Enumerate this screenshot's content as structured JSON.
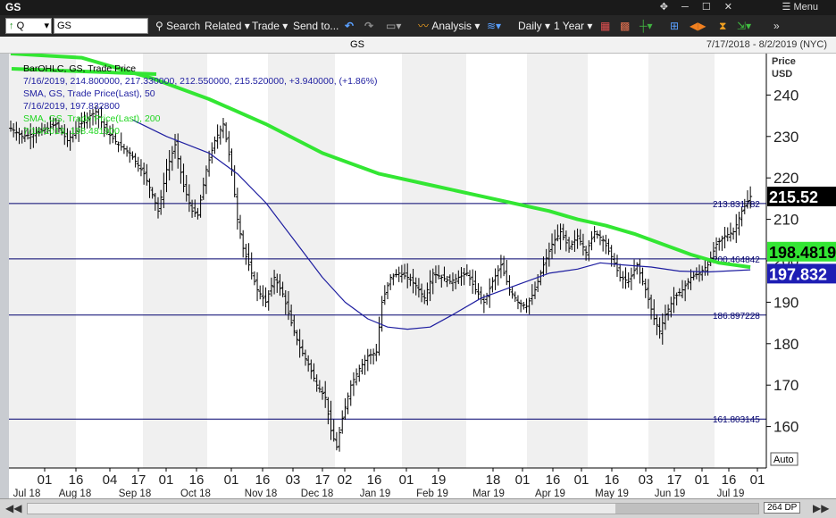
{
  "window": {
    "title": "GS",
    "menu_label": "Menu",
    "window_controls": "✥ ─ ☐ ✕"
  },
  "toolbar": {
    "symbol_type": "Q",
    "symbol_value": "GS",
    "search_label": "Search",
    "related_label": "Related",
    "trade_label": "Trade",
    "send_label": "Send to...",
    "analysis_label": "Analysis",
    "period_label": "Daily",
    "range_label": "1 Year"
  },
  "header": {
    "symbol": "GS",
    "date_range": "7/17/2018 - 8/2/2019 (NYC)"
  },
  "legend": {
    "ohlc_title": "BarOHLC, GS, Trade Price",
    "ohlc_values": "7/16/2019, 214.800000, 217.330000, 212.550000, 215.520000, +3.940000, (+1.86%)",
    "sma50_title": "SMA, GS, Trade Price(Last), 50",
    "sma50_value": "7/16/2019, 197.832800",
    "sma200_title": "SMA, GS, Trade Price(Last), 200",
    "sma200_value": "7/16/2019, 198.481900"
  },
  "axis": {
    "price_label": "Price",
    "unit_label": "USD",
    "auto_label": "Auto"
  },
  "footer": {
    "zoom_label": "264 DP"
  },
  "colors": {
    "ohlc": "#000000",
    "sma50": "#1e1ea0",
    "sma200": "#33e633",
    "hline": "#00006e",
    "band": "#f0f0f0",
    "last_price_bg": "#000000",
    "sma200_bg": "#33e633",
    "sma50_bg": "#1e1eb4"
  },
  "chart_data": {
    "type": "line",
    "title": "GS",
    "ylim": [
      150,
      250
    ],
    "y_ticks": [
      160,
      170,
      180,
      190,
      200,
      210,
      220,
      230,
      240
    ],
    "y_tick_labels": [
      "160",
      "170",
      "180",
      "190",
      "200",
      "210",
      "220",
      "230",
      "240"
    ],
    "x_tick_labels": [
      "01",
      "16",
      "04",
      "17",
      "01",
      "16",
      "01",
      "16",
      "03",
      "17",
      "02",
      "16",
      "01",
      "19",
      "18",
      "01",
      "16",
      "01",
      "16",
      "03",
      "17",
      "01",
      "16",
      "01"
    ],
    "month_labels": [
      "Jul 18",
      "Aug 18",
      "Sep 18",
      "Oct 18",
      "Nov 18",
      "Dec 18",
      "Jan 19",
      "Feb 19",
      "Mar 19",
      "Apr 19",
      "May 19",
      "Jun 19",
      "Jul 19"
    ],
    "horizontal_lines": [
      {
        "value": 213.831782,
        "label": "213.831782"
      },
      {
        "value": 200.464842,
        "label": "200.464842"
      },
      {
        "value": 186.897228,
        "label": "186.897228"
      },
      {
        "value": 161.803145,
        "label": "161.803145"
      }
    ],
    "value_badges": [
      {
        "name": "last",
        "label": "215.52",
        "value": 215.52
      },
      {
        "name": "sma200",
        "label": "198.4819",
        "value": 198.4819
      },
      {
        "name": "sma50",
        "label": "197.832",
        "value": 197.832
      }
    ],
    "close_series": [
      {
        "t": 0,
        "v": 232
      },
      {
        "t": 4,
        "v": 230
      },
      {
        "t": 10,
        "v": 231
      },
      {
        "t": 16,
        "v": 233
      },
      {
        "t": 20,
        "v": 229
      },
      {
        "t": 26,
        "v": 234
      },
      {
        "t": 30,
        "v": 236
      },
      {
        "t": 34,
        "v": 231
      },
      {
        "t": 38,
        "v": 228
      },
      {
        "t": 42,
        "v": 226
      },
      {
        "t": 47,
        "v": 221
      },
      {
        "t": 50,
        "v": 216
      },
      {
        "t": 52,
        "v": 212
      },
      {
        "t": 55,
        "v": 222
      },
      {
        "t": 58,
        "v": 228
      },
      {
        "t": 61,
        "v": 218
      },
      {
        "t": 64,
        "v": 212
      },
      {
        "t": 66,
        "v": 211
      },
      {
        "t": 69,
        "v": 222
      },
      {
        "t": 72,
        "v": 229
      },
      {
        "t": 75,
        "v": 233
      },
      {
        "t": 78,
        "v": 222
      },
      {
        "t": 80,
        "v": 210
      },
      {
        "t": 82,
        "v": 203
      },
      {
        "t": 84,
        "v": 199
      },
      {
        "t": 87,
        "v": 193
      },
      {
        "t": 90,
        "v": 190
      },
      {
        "t": 93,
        "v": 196
      },
      {
        "t": 96,
        "v": 192
      },
      {
        "t": 99,
        "v": 185
      },
      {
        "t": 102,
        "v": 179
      },
      {
        "t": 105,
        "v": 175
      },
      {
        "t": 108,
        "v": 170
      },
      {
        "t": 111,
        "v": 167
      },
      {
        "t": 113,
        "v": 159
      },
      {
        "t": 115,
        "v": 155
      },
      {
        "t": 117,
        "v": 162
      },
      {
        "t": 120,
        "v": 170
      },
      {
        "t": 123,
        "v": 174
      },
      {
        "t": 126,
        "v": 177
      },
      {
        "t": 129,
        "v": 178
      },
      {
        "t": 131,
        "v": 190
      },
      {
        "t": 134,
        "v": 196
      },
      {
        "t": 137,
        "v": 197
      },
      {
        "t": 140,
        "v": 196
      },
      {
        "t": 143,
        "v": 194
      },
      {
        "t": 146,
        "v": 191
      },
      {
        "t": 149,
        "v": 197
      },
      {
        "t": 152,
        "v": 196
      },
      {
        "t": 155,
        "v": 195
      },
      {
        "t": 158,
        "v": 196
      },
      {
        "t": 161,
        "v": 197
      },
      {
        "t": 164,
        "v": 193
      },
      {
        "t": 167,
        "v": 190
      },
      {
        "t": 170,
        "v": 195
      },
      {
        "t": 173,
        "v": 199
      },
      {
        "t": 176,
        "v": 193
      },
      {
        "t": 179,
        "v": 190
      },
      {
        "t": 182,
        "v": 189
      },
      {
        "t": 185,
        "v": 193
      },
      {
        "t": 188,
        "v": 199
      },
      {
        "t": 191,
        "v": 204
      },
      {
        "t": 194,
        "v": 207
      },
      {
        "t": 197,
        "v": 203
      },
      {
        "t": 200,
        "v": 206
      },
      {
        "t": 203,
        "v": 202
      },
      {
        "t": 206,
        "v": 207
      },
      {
        "t": 209,
        "v": 205
      },
      {
        "t": 212,
        "v": 201
      },
      {
        "t": 215,
        "v": 196
      },
      {
        "t": 218,
        "v": 195
      },
      {
        "t": 221,
        "v": 199
      },
      {
        "t": 224,
        "v": 193
      },
      {
        "t": 227,
        "v": 186
      },
      {
        "t": 229,
        "v": 183
      },
      {
        "t": 231,
        "v": 187
      },
      {
        "t": 234,
        "v": 191
      },
      {
        "t": 237,
        "v": 193
      },
      {
        "t": 240,
        "v": 196
      },
      {
        "t": 243,
        "v": 197
      },
      {
        "t": 246,
        "v": 199
      },
      {
        "t": 249,
        "v": 204
      },
      {
        "t": 252,
        "v": 206
      },
      {
        "t": 255,
        "v": 207
      },
      {
        "t": 258,
        "v": 212
      },
      {
        "t": 261,
        "v": 215.52
      }
    ],
    "series": [
      {
        "name": "SMA, GS, Trade Price(Last), 50",
        "points": [
          {
            "t": 43,
            "v": 234
          },
          {
            "t": 55,
            "v": 230
          },
          {
            "t": 70,
            "v": 226
          },
          {
            "t": 80,
            "v": 221
          },
          {
            "t": 90,
            "v": 214
          },
          {
            "t": 100,
            "v": 205
          },
          {
            "t": 110,
            "v": 196
          },
          {
            "t": 118,
            "v": 190
          },
          {
            "t": 126,
            "v": 186
          },
          {
            "t": 133,
            "v": 184
          },
          {
            "t": 140,
            "v": 183.5
          },
          {
            "t": 148,
            "v": 184
          },
          {
            "t": 156,
            "v": 187
          },
          {
            "t": 166,
            "v": 191
          },
          {
            "t": 178,
            "v": 194
          },
          {
            "t": 190,
            "v": 197
          },
          {
            "t": 200,
            "v": 198
          },
          {
            "t": 208,
            "v": 199.5
          },
          {
            "t": 216,
            "v": 199
          },
          {
            "t": 226,
            "v": 198.5
          },
          {
            "t": 236,
            "v": 197.5
          },
          {
            "t": 246,
            "v": 197.3
          },
          {
            "t": 261,
            "v": 197.83
          }
        ]
      },
      {
        "name": "SMA, GS, Trade Price(Last), 200",
        "points": [
          {
            "t": 0,
            "v": 250
          },
          {
            "t": 25,
            "v": 249
          },
          {
            "t": 50,
            "v": 244
          },
          {
            "t": 70,
            "v": 239
          },
          {
            "t": 90,
            "v": 233
          },
          {
            "t": 110,
            "v": 226
          },
          {
            "t": 130,
            "v": 221
          },
          {
            "t": 150,
            "v": 218
          },
          {
            "t": 170,
            "v": 215
          },
          {
            "t": 190,
            "v": 212
          },
          {
            "t": 200,
            "v": 210
          },
          {
            "t": 210,
            "v": 208.5
          },
          {
            "t": 220,
            "v": 206.5
          },
          {
            "t": 230,
            "v": 204
          },
          {
            "t": 240,
            "v": 201.5
          },
          {
            "t": 250,
            "v": 199.5
          },
          {
            "t": 261,
            "v": 198.48
          }
        ]
      }
    ],
    "t_range": [
      0,
      266
    ]
  }
}
